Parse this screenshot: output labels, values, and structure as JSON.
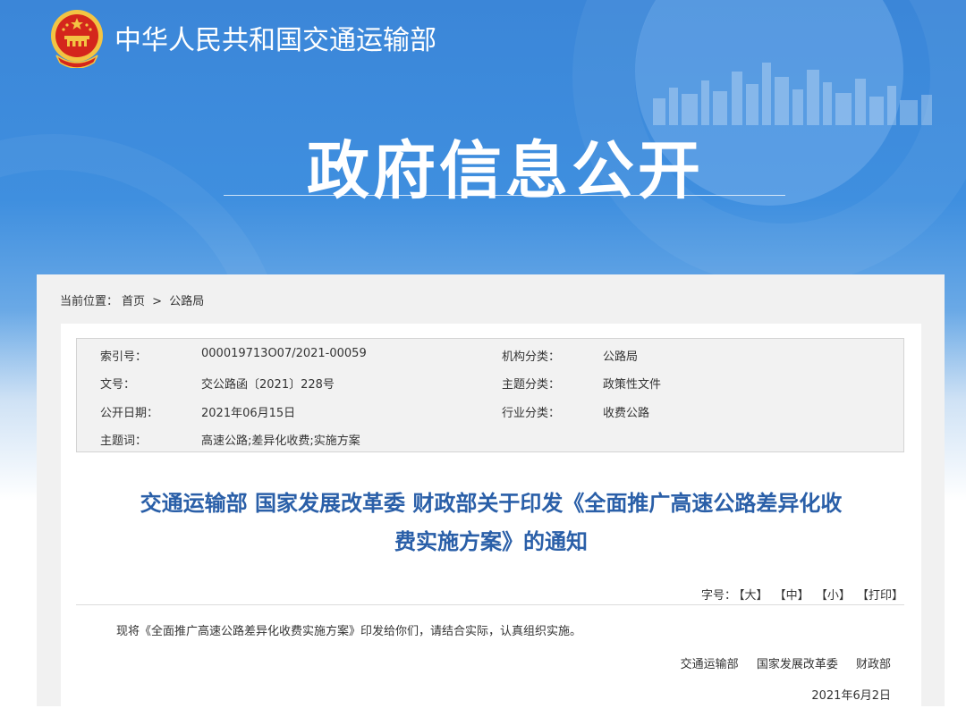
{
  "header": {
    "ministry_name": "中华人民共和国交通运输部",
    "page_title": "政府信息公开",
    "emblem_icon": "national-emblem-icon"
  },
  "breadcrumb": {
    "label": "当前位置：",
    "home": "首页",
    "separator": ">",
    "current": "公路局"
  },
  "meta": {
    "index_label": "索引号：",
    "index_value": "000019713O07/2021-00059",
    "org_label": "机构分类：",
    "org_value": "公路局",
    "docno_label": "文号：",
    "docno_value": "交公路函〔2021〕228号",
    "topic_label": "主题分类：",
    "topic_value": "政策性文件",
    "date_label": "公开日期：",
    "date_value": "2021年06月15日",
    "industry_label": "行业分类：",
    "industry_value": "收费公路",
    "keywords_label": "主题词：",
    "keywords_value": "高速公路;差异化收费;实施方案"
  },
  "document": {
    "title_line1": "交通运输部 国家发展改革委 财政部关于印发《全面推广高速公路差异化收",
    "title_line2": "费实施方案》的通知",
    "font_size_label": "字号：",
    "font_large": "【大】",
    "font_medium": "【中】",
    "font_small": "【小】",
    "print": "【打印】",
    "body": "现将《全面推广高速公路差异化收费实施方案》印发给你们，请结合实际，认真组织实施。",
    "signer1": "交通运输部",
    "signer2": "国家发展改革委",
    "signer3": "财政部",
    "date": "2021年6月2日"
  },
  "colors": {
    "banner_blue": "#3b86d8",
    "title_blue": "#2a5fa8",
    "emblem_red": "#d4261c",
    "emblem_gold": "#f3c443"
  }
}
